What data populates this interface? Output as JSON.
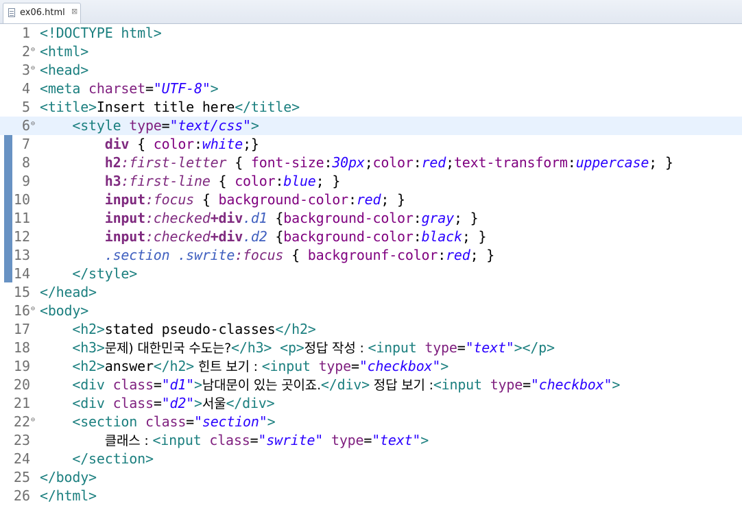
{
  "tab": {
    "filename": "ex06.html",
    "close": "⊠"
  },
  "editor": {
    "current_line": 6,
    "lines": [
      {
        "n": "1",
        "fold": "",
        "parts": [
          [
            "tag",
            "<!DOCTYPE html>"
          ]
        ]
      },
      {
        "n": "2",
        "fold": "⊖",
        "parts": [
          [
            "tag",
            "<html>"
          ]
        ]
      },
      {
        "n": "3",
        "fold": "⊖",
        "parts": [
          [
            "tag",
            "<head>"
          ]
        ]
      },
      {
        "n": "4",
        "fold": "",
        "parts": [
          [
            "tag",
            "<meta "
          ],
          [
            "attr",
            "charset"
          ],
          [
            "text",
            "="
          ],
          [
            "val",
            "\"UTF-8\""
          ],
          [
            "tag",
            ">"
          ]
        ]
      },
      {
        "n": "5",
        "fold": "",
        "parts": [
          [
            "tag",
            "<title>"
          ],
          [
            "text",
            "Insert title here"
          ],
          [
            "tag",
            "</title>"
          ]
        ]
      },
      {
        "n": "6",
        "fold": "⊖",
        "parts": [
          [
            "text",
            "    "
          ],
          [
            "tag",
            "<style "
          ],
          [
            "attr",
            "type"
          ],
          [
            "text",
            "="
          ],
          [
            "val",
            "\"text/css\""
          ],
          [
            "tag",
            ">"
          ]
        ]
      },
      {
        "n": "7",
        "fold": "",
        "parts": [
          [
            "text",
            "        "
          ],
          [
            "sel",
            "div"
          ],
          [
            "text",
            " { "
          ],
          [
            "prop",
            "color"
          ],
          [
            "text",
            ":"
          ],
          [
            "pval",
            "white"
          ],
          [
            "text",
            ";}"
          ]
        ]
      },
      {
        "n": "8",
        "fold": "",
        "parts": [
          [
            "text",
            "        "
          ],
          [
            "sel",
            "h2"
          ],
          [
            "pseudo",
            ":first-letter"
          ],
          [
            "text",
            " { "
          ],
          [
            "prop",
            "font-size"
          ],
          [
            "text",
            ":"
          ],
          [
            "pval",
            "30px"
          ],
          [
            "text",
            ";"
          ],
          [
            "prop",
            "color"
          ],
          [
            "text",
            ":"
          ],
          [
            "pval",
            "red"
          ],
          [
            "text",
            ";"
          ],
          [
            "prop",
            "text-transform"
          ],
          [
            "text",
            ":"
          ],
          [
            "pval",
            "uppercase"
          ],
          [
            "text",
            "; }"
          ]
        ]
      },
      {
        "n": "9",
        "fold": "",
        "parts": [
          [
            "text",
            "        "
          ],
          [
            "sel",
            "h3"
          ],
          [
            "pseudo",
            ":first-line"
          ],
          [
            "text",
            " { "
          ],
          [
            "prop",
            "color"
          ],
          [
            "text",
            ":"
          ],
          [
            "pval",
            "blue"
          ],
          [
            "text",
            "; }"
          ]
        ]
      },
      {
        "n": "10",
        "fold": "",
        "parts": [
          [
            "text",
            "        "
          ],
          [
            "sel",
            "input"
          ],
          [
            "pseudo",
            ":focus"
          ],
          [
            "text",
            " { "
          ],
          [
            "prop",
            "background-color"
          ],
          [
            "text",
            ":"
          ],
          [
            "pval",
            "red"
          ],
          [
            "text",
            "; }"
          ]
        ]
      },
      {
        "n": "11",
        "fold": "",
        "parts": [
          [
            "text",
            "        "
          ],
          [
            "sel",
            "input"
          ],
          [
            "pseudo",
            ":checked"
          ],
          [
            "sel",
            "+div"
          ],
          [
            "class",
            ".d1"
          ],
          [
            "text",
            " {"
          ],
          [
            "prop",
            "background-color"
          ],
          [
            "text",
            ":"
          ],
          [
            "pval",
            "gray"
          ],
          [
            "text",
            "; }"
          ]
        ]
      },
      {
        "n": "12",
        "fold": "",
        "parts": [
          [
            "text",
            "        "
          ],
          [
            "sel",
            "input"
          ],
          [
            "pseudo",
            ":checked"
          ],
          [
            "sel",
            "+div"
          ],
          [
            "class",
            ".d2"
          ],
          [
            "text",
            " {"
          ],
          [
            "prop",
            "background-color"
          ],
          [
            "text",
            ":"
          ],
          [
            "pval",
            "black"
          ],
          [
            "text",
            "; }"
          ]
        ]
      },
      {
        "n": "13",
        "fold": "",
        "parts": [
          [
            "text",
            "        "
          ],
          [
            "class",
            ".section .swrite"
          ],
          [
            "pseudo",
            ":focus"
          ],
          [
            "text",
            " { "
          ],
          [
            "prop",
            "backgrounf-color"
          ],
          [
            "text",
            ":"
          ],
          [
            "pval",
            "red"
          ],
          [
            "text",
            "; }"
          ]
        ]
      },
      {
        "n": "14",
        "fold": "",
        "parts": [
          [
            "text",
            "    "
          ],
          [
            "tag",
            "</style>"
          ]
        ]
      },
      {
        "n": "15",
        "fold": "",
        "parts": [
          [
            "tag",
            "</head>"
          ]
        ]
      },
      {
        "n": "16",
        "fold": "⊖",
        "parts": [
          [
            "tag",
            "<body>"
          ]
        ]
      },
      {
        "n": "17",
        "fold": "",
        "parts": [
          [
            "text",
            "    "
          ],
          [
            "tag",
            "<h2>"
          ],
          [
            "text",
            "stated pseudo-classes"
          ],
          [
            "tag",
            "</h2>"
          ]
        ]
      },
      {
        "n": "18",
        "fold": "",
        "parts": [
          [
            "text",
            "    "
          ],
          [
            "tag",
            "<h3>"
          ],
          [
            "kr",
            "문제) 대한민국 수도는?"
          ],
          [
            "tag",
            "</h3>"
          ],
          [
            "text",
            " "
          ],
          [
            "tag",
            "<p>"
          ],
          [
            "kr",
            "정답 작성 : "
          ],
          [
            "tag",
            "<input "
          ],
          [
            "attr",
            "type"
          ],
          [
            "text",
            "="
          ],
          [
            "val",
            "\"text\""
          ],
          [
            "tag",
            "></p>"
          ]
        ]
      },
      {
        "n": "19",
        "fold": "",
        "parts": [
          [
            "text",
            "    "
          ],
          [
            "tag",
            "<h2>"
          ],
          [
            "text",
            "answer"
          ],
          [
            "tag",
            "</h2>"
          ],
          [
            "kr",
            " 힌트 보기 : "
          ],
          [
            "tag",
            "<input "
          ],
          [
            "attr",
            "type"
          ],
          [
            "text",
            "="
          ],
          [
            "val",
            "\"checkbox\""
          ],
          [
            "tag",
            ">"
          ]
        ]
      },
      {
        "n": "20",
        "fold": "",
        "parts": [
          [
            "text",
            "    "
          ],
          [
            "tag",
            "<div "
          ],
          [
            "attr",
            "class"
          ],
          [
            "text",
            "="
          ],
          [
            "val",
            "\"d1\""
          ],
          [
            "tag",
            ">"
          ],
          [
            "kr",
            "남대문이 있는 곳이죠."
          ],
          [
            "tag",
            "</div>"
          ],
          [
            "kr",
            " 정답 보기 :"
          ],
          [
            "tag",
            "<input "
          ],
          [
            "attr",
            "type"
          ],
          [
            "text",
            "="
          ],
          [
            "val",
            "\"checkbox\""
          ],
          [
            "tag",
            ">"
          ]
        ]
      },
      {
        "n": "21",
        "fold": "",
        "parts": [
          [
            "text",
            "    "
          ],
          [
            "tag",
            "<div "
          ],
          [
            "attr",
            "class"
          ],
          [
            "text",
            "="
          ],
          [
            "val",
            "\"d2\""
          ],
          [
            "tag",
            ">"
          ],
          [
            "kr",
            "서울"
          ],
          [
            "tag",
            "</div>"
          ]
        ]
      },
      {
        "n": "22",
        "fold": "⊖",
        "parts": [
          [
            "text",
            "    "
          ],
          [
            "tag",
            "<section "
          ],
          [
            "attr",
            "class"
          ],
          [
            "text",
            "="
          ],
          [
            "val",
            "\"section\""
          ],
          [
            "tag",
            ">"
          ]
        ]
      },
      {
        "n": "23",
        "fold": "",
        "parts": [
          [
            "text",
            "        "
          ],
          [
            "kr",
            "클래스 : "
          ],
          [
            "tag",
            "<input "
          ],
          [
            "attr",
            "class"
          ],
          [
            "text",
            "="
          ],
          [
            "val",
            "\"swrite\""
          ],
          [
            "text",
            " "
          ],
          [
            "attr",
            "type"
          ],
          [
            "text",
            "="
          ],
          [
            "val",
            "\"text\""
          ],
          [
            "tag",
            ">"
          ]
        ]
      },
      {
        "n": "24",
        "fold": "",
        "parts": [
          [
            "text",
            "    "
          ],
          [
            "tag",
            "</section>"
          ]
        ]
      },
      {
        "n": "25",
        "fold": "",
        "parts": [
          [
            "tag",
            "</body>"
          ]
        ]
      },
      {
        "n": "26",
        "fold": "",
        "parts": [
          [
            "tag",
            "</html>"
          ]
        ]
      }
    ]
  }
}
